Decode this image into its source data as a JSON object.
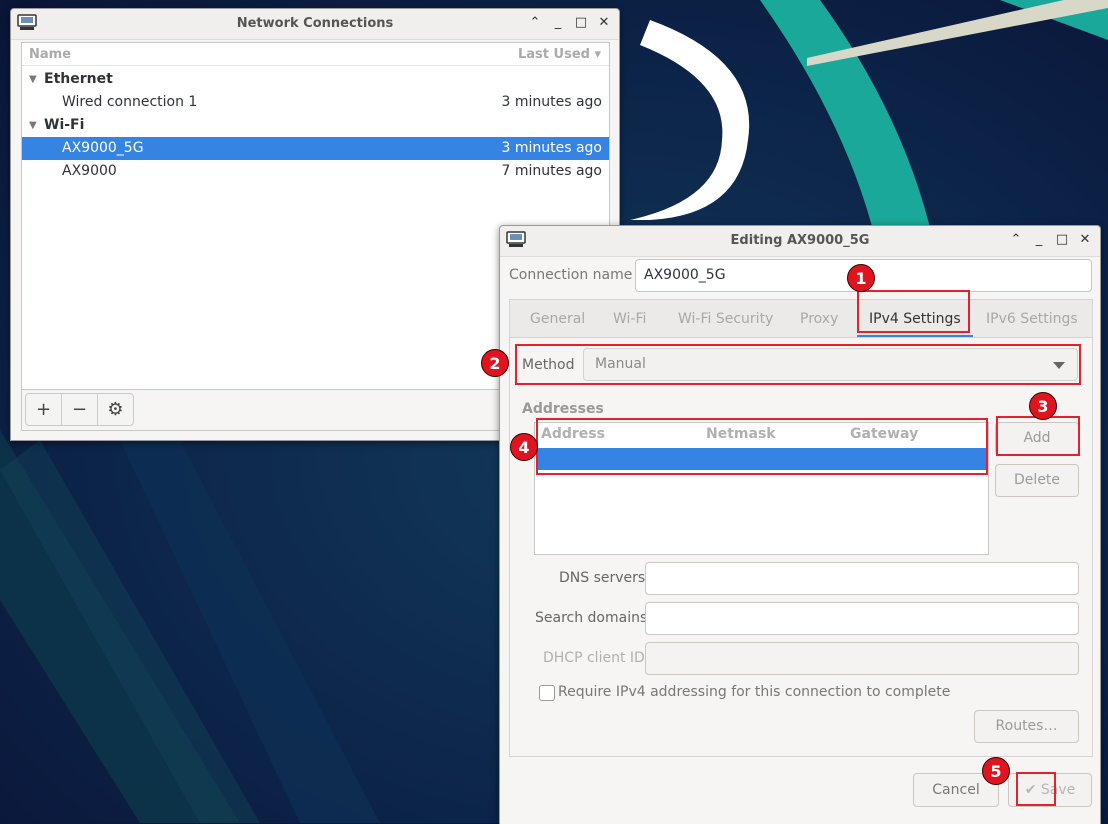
{
  "net_window": {
    "title": "Network Connections",
    "columns": {
      "name": "Name",
      "last_used": "Last Used ▾"
    },
    "rows": [
      {
        "label": "Ethernet",
        "time": ""
      },
      {
        "label": "Wired connection 1",
        "time": "3 minutes ago"
      },
      {
        "label": "Wi-Fi",
        "time": ""
      },
      {
        "label": "AX9000_5G",
        "time": "3 minutes ago"
      },
      {
        "label": "AX9000",
        "time": "7 minutes ago"
      }
    ],
    "toolbar": {
      "add": "+",
      "remove": "−",
      "settings": "⚙"
    }
  },
  "window_controls": {
    "minimize": "⌃",
    "restore": "_",
    "maximize": "□",
    "close": "✕"
  },
  "edit_window": {
    "title": "Editing AX9000_5G",
    "connection_name_label": "Connection name",
    "connection_name_value": "AX9000_5G",
    "tabs": [
      "General",
      "Wi-Fi",
      "Wi-Fi Security",
      "Proxy",
      "IPv4 Settings",
      "IPv6 Settings"
    ],
    "active_tab": "IPv4 Settings",
    "method_label": "Method",
    "method_value": "Manual",
    "addresses_title": "Addresses",
    "address_columns": [
      "Address",
      "Netmask",
      "Gateway"
    ],
    "add_button": "Add",
    "delete_button": "Delete",
    "dns_label": "DNS servers",
    "dns_value": "",
    "search_domains_label": "Search domains",
    "search_domains_value": "",
    "dhcp_client_id_label": "DHCP client ID",
    "dhcp_client_id_value": "",
    "require_ipv4_label": "Require IPv4 addressing for this connection to complete",
    "routes_button": "Routes…",
    "cancel_button": "Cancel",
    "save_button": "✔ Save"
  },
  "annotations": [
    "1",
    "2",
    "3",
    "4",
    "5"
  ],
  "colors": {
    "selection": "#3584e4",
    "annotation_red": "#e0242f",
    "desktop_bg": "#0a1a3a",
    "desktop_accent": "#1aa89a"
  }
}
